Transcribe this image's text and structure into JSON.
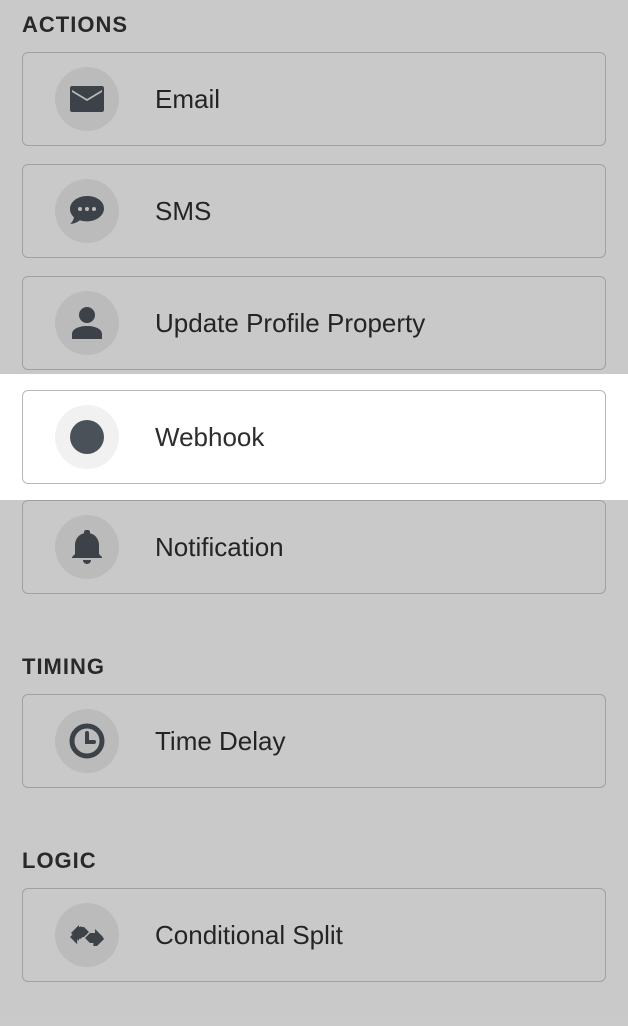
{
  "sections": {
    "actions": {
      "heading": "ACTIONS",
      "items": [
        {
          "label": "Email",
          "icon": "email-icon"
        },
        {
          "label": "SMS",
          "icon": "sms-icon"
        },
        {
          "label": "Update Profile Property",
          "icon": "person-icon"
        },
        {
          "label": "Webhook",
          "icon": "webhook-icon",
          "highlighted": true
        },
        {
          "label": "Notification",
          "icon": "bell-icon"
        }
      ]
    },
    "timing": {
      "heading": "TIMING",
      "items": [
        {
          "label": "Time Delay",
          "icon": "clock-icon"
        }
      ]
    },
    "logic": {
      "heading": "LOGIC",
      "items": [
        {
          "label": "Conditional Split",
          "icon": "split-icon"
        }
      ]
    }
  }
}
